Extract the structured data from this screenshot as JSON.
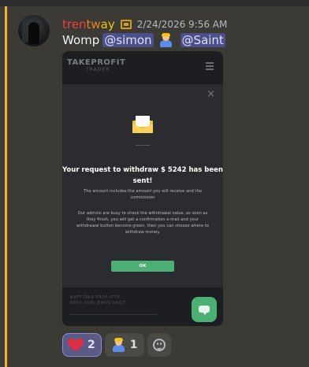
{
  "message": {
    "username_parts": [
      "tren",
      "tw",
      "ay"
    ],
    "timestamp": "2/24/2026 9:56 AM",
    "text": "Womp",
    "mentions": [
      "@simon",
      "@Saint"
    ]
  },
  "attachment": {
    "logo": "TAKEPROFIT",
    "logo_sub": "TRADER",
    "close_glyph": "×",
    "title": "Your request to withdraw $ 5242 has been sent!",
    "subtitle": "The amount includes the amount you will receive and the commission",
    "body": "Our admins are busy to check the withdrawal value, as soon as they finish, you will get a confirmation e-mail and your withdrawal button become green, then you can choose where to withdraw money.",
    "ok_label": "OK",
    "below_text": "B9FT-TAKE-PROF-ITTR\nK0PU-D08L-EW3G-NKG7"
  },
  "reactions": [
    {
      "emoji": "heart-icon",
      "count": "2",
      "me": true
    },
    {
      "emoji": "person-emoji-icon",
      "count": "1",
      "me": false
    }
  ],
  "colors": {
    "accent_mention": "#4b4f8a",
    "highlight_bar": "#f0b232",
    "ok_green": "#4caf73"
  }
}
